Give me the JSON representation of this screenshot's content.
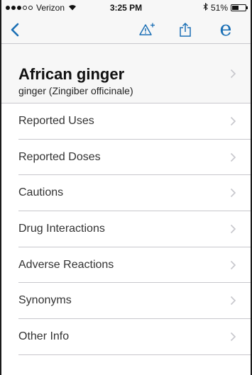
{
  "status_bar": {
    "carrier": "Verizon",
    "time": "3:25 PM",
    "battery_text": "51%",
    "battery_level": 0.51,
    "signal_bars_filled": 3,
    "signal_bars_total": 5
  },
  "nav": {
    "back_icon": "chevron-left-icon",
    "alert_icon": "add-alert-icon",
    "share_icon": "share-icon",
    "e_label": "e",
    "tint_color": "#1a6fb5"
  },
  "header": {
    "title": "African ginger",
    "subtitle": "ginger (Zingiber officinale)"
  },
  "list": {
    "items": [
      {
        "label": "Reported Uses"
      },
      {
        "label": "Reported Doses"
      },
      {
        "label": "Cautions"
      },
      {
        "label": "Drug Interactions"
      },
      {
        "label": "Adverse Reactions"
      },
      {
        "label": "Synonyms"
      },
      {
        "label": "Other Info"
      }
    ]
  }
}
